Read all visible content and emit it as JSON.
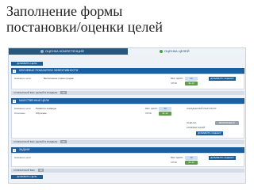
{
  "slide": {
    "title_line1": "Заполнение формы",
    "title_line2": "постановки/оценки  целей"
  },
  "tabs": {
    "left_label": "ОЦЕНКА КОМПЕТЕНЦИЙ",
    "right_label": "ОЦЕНКА ЦЕЛЕЙ"
  },
  "top_button": "ДОБАВИТЬ ЦЕЛЬ",
  "sections": [
    {
      "header": "КЛЮЧЕВЫЕ ПОКАЗАТЕЛИ ЭФФЕКТИВНОСТИ",
      "goal_label": "Название цели",
      "goal_value": "Выполнение плана продаж",
      "weight_label": "ВЕС ЦЕЛИ",
      "weight_value": "40",
      "term_label": "СРОК",
      "term_value": "31.12",
      "add_button": "ДОБАВИТЬ ОЦЕНКУ",
      "footer_label": "СУММАРНЫЙ ВЕС ЦЕЛЕЙ В РАЗДЕЛЕ",
      "footer_value": "40"
    },
    {
      "header": "КАЧЕСТВЕННЫЕ ЦЕЛИ",
      "goal_label": "Название цели",
      "goal_value": "Развитие команды",
      "desc_label": "Описание",
      "desc_value": "Обучение",
      "weight_label": "ВЕС ЦЕЛИ",
      "weight_value": "30",
      "term_label": "СРОК",
      "term_value": "31.12",
      "result_label": "ОЖИДАЕМЫЙ РЕЗУЛЬТАТ",
      "assess_label": "ОЦЕНКА",
      "assess_value": "ВЫПОЛНЕНО",
      "comment_label": "КОММЕНТАРИЙ",
      "add_button": "ДОБАВИТЬ ОЦЕНКУ",
      "footer_label": "СУММАРНЫЙ ВЕС ЦЕЛЕЙ В РАЗДЕЛЕ",
      "footer_value": "30"
    },
    {
      "header": "ЗАДАЧИ",
      "goal_label": "Название цели",
      "weight_label": "ВЕС ЦЕЛИ",
      "weight_value": "30",
      "term_label": "СРОК",
      "term_value": "31.12",
      "add_button": "ДОБАВИТЬ ОЦЕНКУ",
      "footer_label": "СУММАРНЫЙ ВЕС",
      "footer_value": "30"
    }
  ],
  "bottom_button": "ДОБАВИТЬ ЦЕЛЬ"
}
